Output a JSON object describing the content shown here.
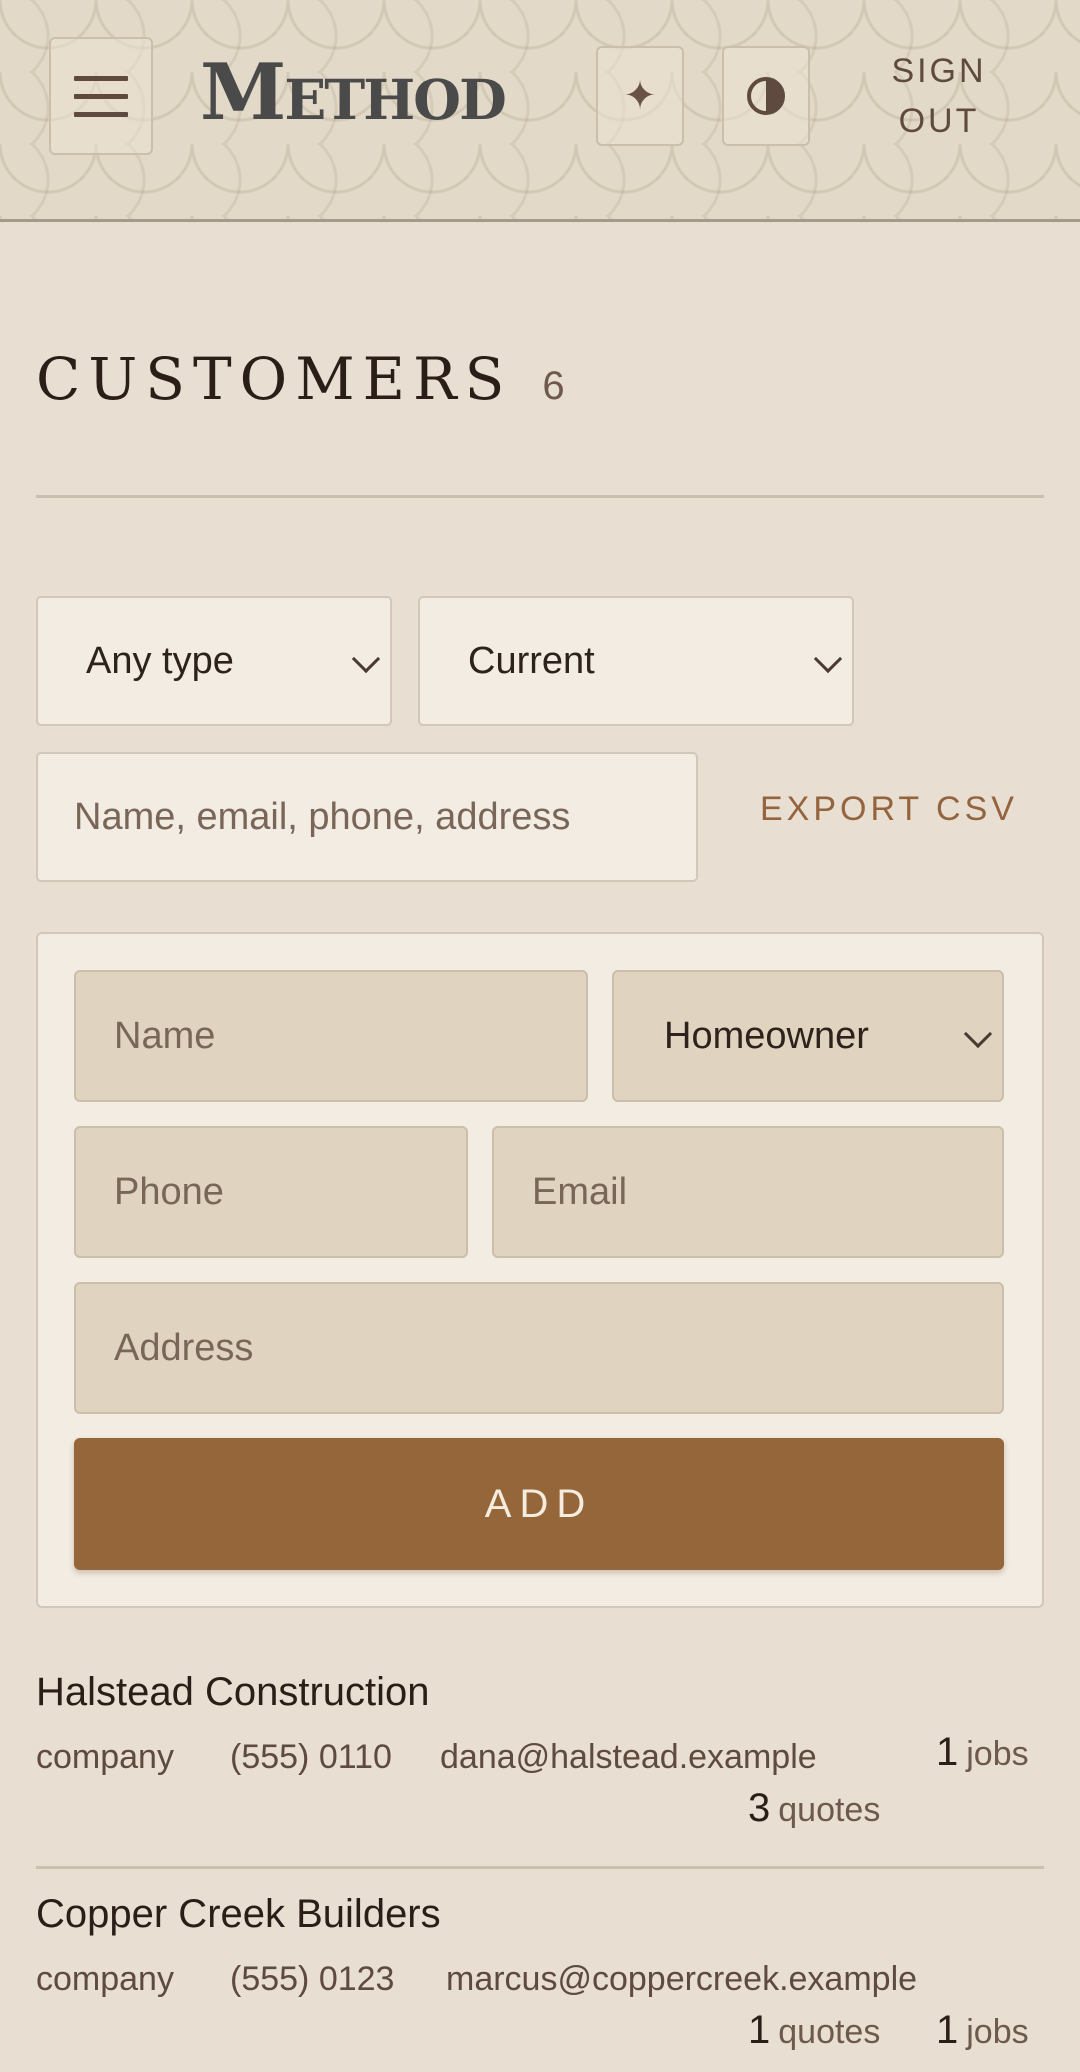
{
  "header": {
    "logo": "Method",
    "sign_out": "SIGN OUT",
    "spark_symbol": "✦",
    "icons": [
      "menu-icon",
      "sparkle-icon",
      "contrast-icon"
    ]
  },
  "page": {
    "title": "CUSTOMERS",
    "count": "6"
  },
  "filters": {
    "type_selected": "Any type",
    "status_selected": "Current",
    "search_placeholder": "Name, email, phone, address",
    "export_label": "EXPORT CSV"
  },
  "add_form": {
    "name_placeholder": "Name",
    "kind_selected": "Homeowner",
    "phone_placeholder": "Phone",
    "email_placeholder": "Email",
    "address_placeholder": "Address",
    "add_label": "ADD"
  },
  "customers": [
    {
      "name": "Halstead Construction",
      "kind": "company",
      "phone": "(555) 0110",
      "email": "dana@halstead.example",
      "jobs_n": "1",
      "jobs_label": "jobs",
      "quotes_n": "3",
      "quotes_label": "quotes"
    },
    {
      "name": "Copper Creek Builders",
      "kind": "company",
      "phone": "(555) 0123",
      "email": "marcus@coppercreek.example",
      "quotes_n": "1",
      "quotes_label": "quotes",
      "jobs_n": "1",
      "jobs_label": "jobs"
    }
  ],
  "colors": {
    "accent": "#956639",
    "background": "#e8dfd2",
    "field": "#f2ece2"
  }
}
